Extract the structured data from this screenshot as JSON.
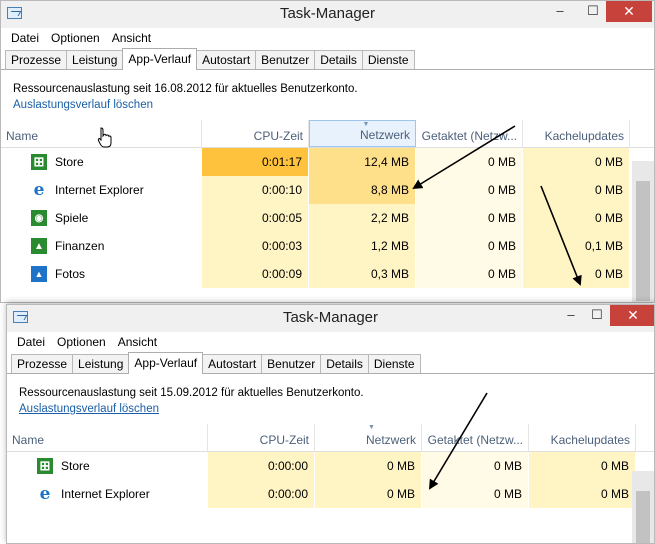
{
  "window1": {
    "title": "Task-Manager",
    "controls": {
      "minimize": "–",
      "maximize": "☐",
      "close": "✕"
    },
    "menu": [
      "Datei",
      "Optionen",
      "Ansicht"
    ],
    "tabs": [
      "Prozesse",
      "Leistung",
      "App-Verlauf",
      "Autostart",
      "Benutzer",
      "Details",
      "Dienste"
    ],
    "active_tab": "App-Verlauf",
    "info_text": "Ressourcenauslastung seit 16.08.2012 für aktuelles Benutzerkonto.",
    "link_text": "Auslastungsverlauf löschen",
    "columns": [
      "Name",
      "CPU-Zeit",
      "Netzwerk",
      "Getaktet (Netzw...",
      "Kachelupdates"
    ],
    "rows": [
      {
        "icon": "store-icon",
        "name": "Store",
        "cpu": "0:01:17",
        "net": "12,4 MB",
        "metered": "0 MB",
        "tile": "0 MB"
      },
      {
        "icon": "internet-explorer-icon",
        "name": "Internet Explorer",
        "cpu": "0:00:10",
        "net": "8,8 MB",
        "metered": "0 MB",
        "tile": "0 MB"
      },
      {
        "icon": "games-icon",
        "name": "Spiele",
        "cpu": "0:00:05",
        "net": "2,2 MB",
        "metered": "0 MB",
        "tile": "0 MB"
      },
      {
        "icon": "finance-icon",
        "name": "Finanzen",
        "cpu": "0:00:03",
        "net": "1,2 MB",
        "metered": "0 MB",
        "tile": "0,1 MB"
      },
      {
        "icon": "photos-icon",
        "name": "Fotos",
        "cpu": "0:00:09",
        "net": "0,3 MB",
        "metered": "0 MB",
        "tile": "0 MB"
      }
    ]
  },
  "window2": {
    "title": "Task-Manager",
    "controls": {
      "minimize": "–",
      "maximize": "☐",
      "close": "✕"
    },
    "menu": [
      "Datei",
      "Optionen",
      "Ansicht"
    ],
    "tabs": [
      "Prozesse",
      "Leistung",
      "App-Verlauf",
      "Autostart",
      "Benutzer",
      "Details",
      "Dienste"
    ],
    "active_tab": "App-Verlauf",
    "info_text": "Ressourcenauslastung seit 15.09.2012 für aktuelles Benutzerkonto.",
    "link_text": "Auslastungsverlauf löschen",
    "columns": [
      "Name",
      "CPU-Zeit",
      "Netzwerk",
      "Getaktet (Netzw...",
      "Kachelupdates"
    ],
    "rows": [
      {
        "icon": "store-icon",
        "name": "Store",
        "cpu": "0:00:00",
        "net": "0 MB",
        "metered": "0 MB",
        "tile": "0 MB"
      },
      {
        "icon": "internet-explorer-icon",
        "name": "Internet Explorer",
        "cpu": "0:00:00",
        "net": "0 MB",
        "metered": "0 MB",
        "tile": "0 MB"
      }
    ]
  },
  "colors": {
    "heat_low": "#fff4c4",
    "heat_mid": "#ffe08a",
    "heat_high": "#ffc23d",
    "link": "#1a5ea8",
    "close_button": "#c7423a",
    "store_green": "#2a8a2f",
    "ie_blue": "#1e73c8"
  }
}
